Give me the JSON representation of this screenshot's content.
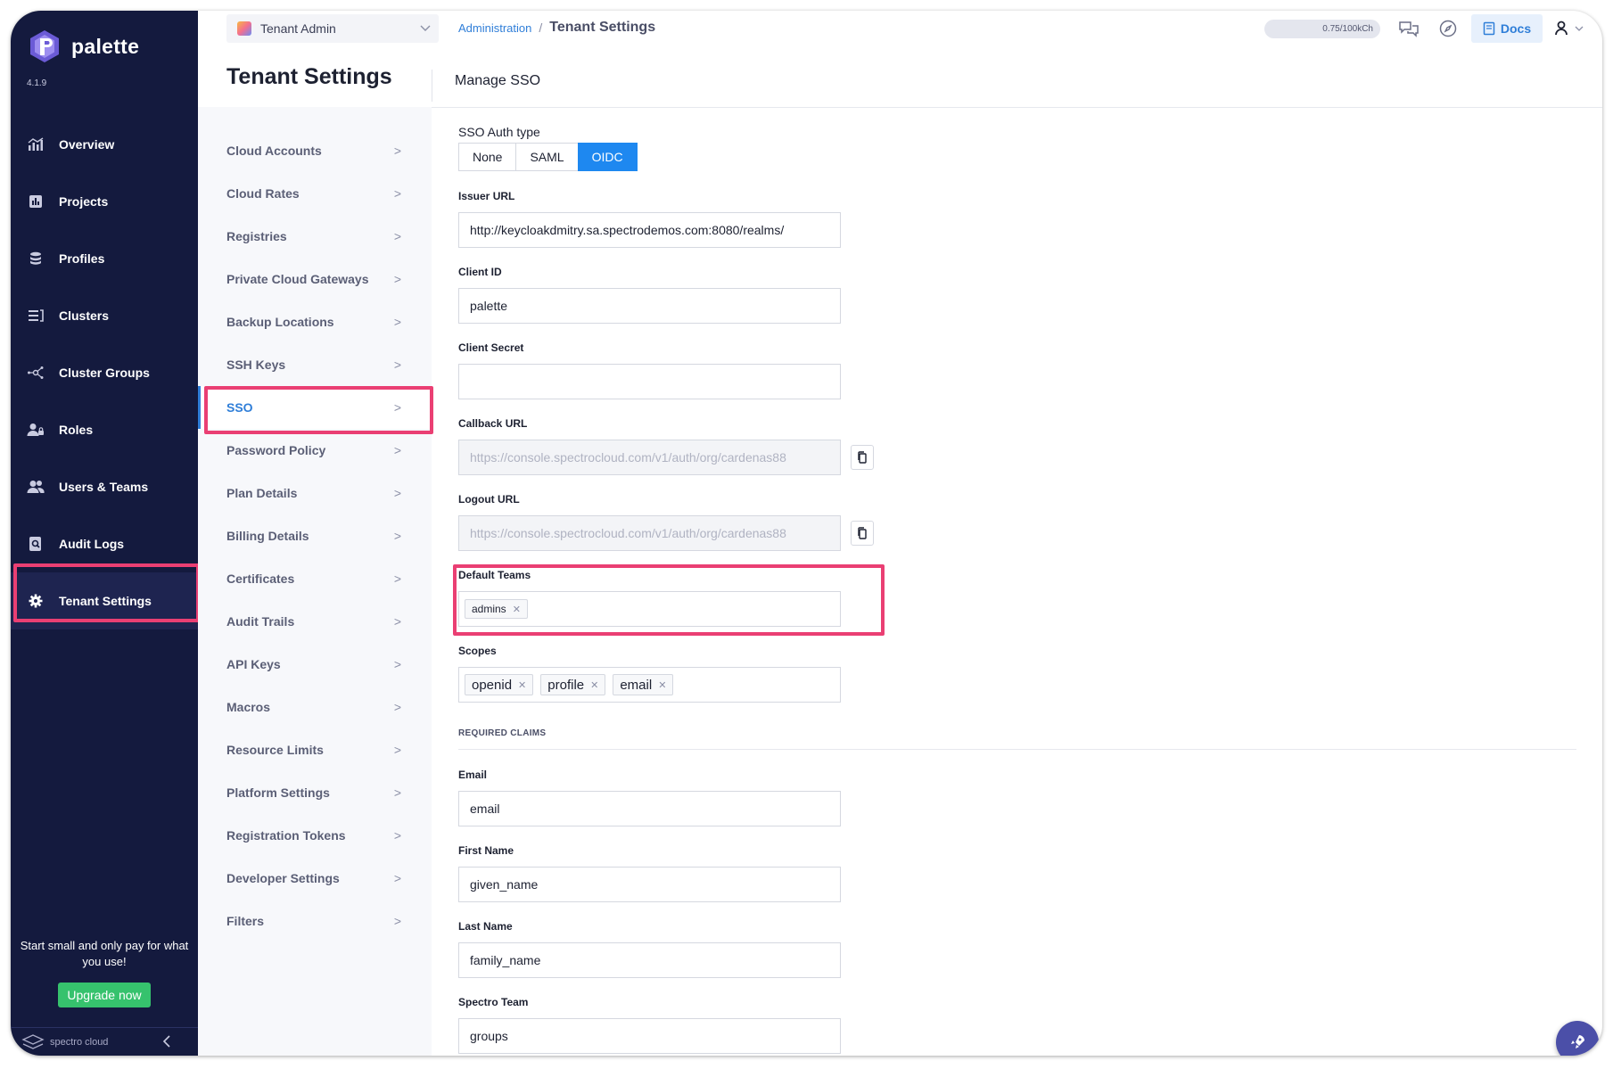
{
  "app": {
    "brand_name": "palette",
    "version": "4.1.9"
  },
  "sidebar": {
    "items": [
      {
        "label": "Overview",
        "icon": "chart-icon"
      },
      {
        "label": "Projects",
        "icon": "bar-chart-icon"
      },
      {
        "label": "Profiles",
        "icon": "stack-icon"
      },
      {
        "label": "Clusters",
        "icon": "list-icon"
      },
      {
        "label": "Cluster Groups",
        "icon": "network-icon"
      },
      {
        "label": "Roles",
        "icon": "user-lock-icon"
      },
      {
        "label": "Users & Teams",
        "icon": "users-icon"
      },
      {
        "label": "Audit Logs",
        "icon": "search-doc-icon"
      },
      {
        "label": "Tenant Settings",
        "icon": "gear-icon"
      }
    ],
    "active": "Tenant Settings",
    "promo_text": "Start small and only pay for what you use!",
    "upgrade_label": "Upgrade now",
    "footer_brand": "spectro cloud"
  },
  "topbar": {
    "scope": "Tenant Admin",
    "breadcrumb_root": "Administration",
    "breadcrumb_sep": "/",
    "breadcrumb_current": "Tenant Settings",
    "usage": "0.75/100kCh",
    "docs_label": "Docs"
  },
  "page": {
    "title": "Tenant Settings",
    "section_title": "Manage SSO"
  },
  "settings_menu": {
    "items": [
      "Cloud Accounts",
      "Cloud Rates",
      "Registries",
      "Private Cloud Gateways",
      "Backup Locations",
      "SSH Keys",
      "SSO",
      "Password Policy",
      "Plan Details",
      "Billing Details",
      "Certificates",
      "Audit Trails",
      "API Keys",
      "Macros",
      "Resource Limits",
      "Platform Settings",
      "Registration Tokens",
      "Developer Settings",
      "Filters"
    ],
    "active": "SSO",
    "arrow": ">"
  },
  "sso_form": {
    "auth_type_label": "SSO Auth type",
    "auth_types": [
      "None",
      "SAML",
      "OIDC"
    ],
    "auth_type_selected": "OIDC",
    "issuer_url_label": "Issuer URL",
    "issuer_url": "http://keycloakdmitry.sa.spectrodemos.com:8080/realms/",
    "client_id_label": "Client ID",
    "client_id": "palette",
    "client_secret_label": "Client Secret",
    "client_secret": "",
    "callback_url_label": "Callback URL",
    "callback_url": "https://console.spectrocloud.com/v1/auth/org/cardenas88",
    "logout_url_label": "Logout URL",
    "logout_url": "https://console.spectrocloud.com/v1/auth/org/cardenas88",
    "default_teams_label": "Default Teams",
    "default_teams": [
      "admins"
    ],
    "scopes_label": "Scopes",
    "scopes": [
      "openid",
      "profile",
      "email"
    ],
    "required_claims_heading": "REQUIRED CLAIMS",
    "email_label": "Email",
    "email": "email",
    "first_name_label": "First Name",
    "first_name": "given_name",
    "last_name_label": "Last Name",
    "last_name": "family_name",
    "spectro_team_label": "Spectro Team",
    "spectro_team": "groups"
  },
  "colors": {
    "sidebar_bg": "#141a3e",
    "accent": "#1e88f0",
    "highlight": "#ea3f73",
    "upgrade_green": "#36c26d"
  }
}
